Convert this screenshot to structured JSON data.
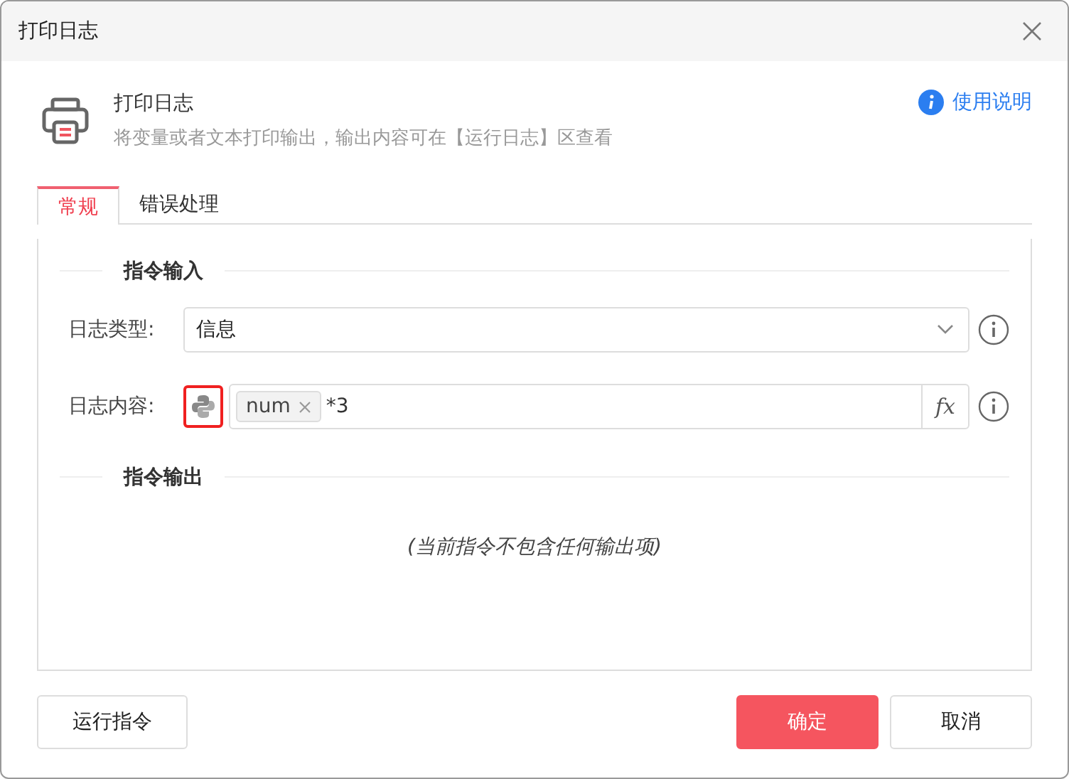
{
  "window": {
    "title": "打印日志"
  },
  "header": {
    "title": "打印日志",
    "description": "将变量或者文本打印输出，输出内容可在【运行日志】区查看",
    "help_link": "使用说明"
  },
  "tabs": [
    {
      "label": "常规",
      "selected": true
    },
    {
      "label": "错误处理",
      "selected": false
    }
  ],
  "input_section": {
    "title": "指令输入",
    "fields": [
      {
        "kind": "select",
        "label": "日志类型:",
        "value": "信息"
      },
      {
        "kind": "expression",
        "label": "日志内容:",
        "python_selected": true,
        "tag": "num",
        "value": "*3",
        "fx": "fx"
      }
    ]
  },
  "output_section": {
    "title": "指令输出",
    "empty_text": "(当前指令不包含任何输出项)"
  },
  "buttons": [
    {
      "label": "运行指令",
      "kind": "plain"
    },
    {
      "label": "确定",
      "kind": "primary"
    },
    {
      "label": "取消",
      "kind": "plain"
    }
  ]
}
